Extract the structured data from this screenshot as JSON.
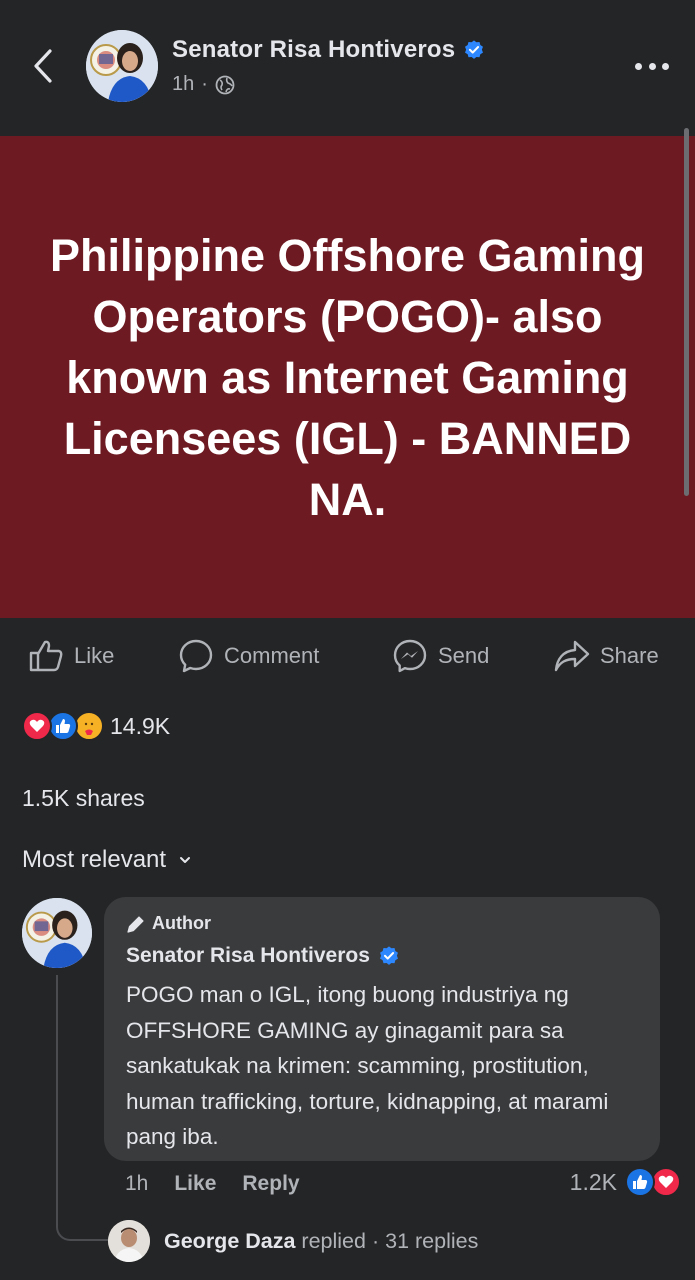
{
  "header": {
    "author_name": "Senator Risa Hontiveros",
    "time": "1h",
    "separator": "·"
  },
  "post": {
    "banner_text": "Philippine Offshore Gaming Operators (POGO)- also known as Internet Gaming Licensees (IGL) - BANNED NA.",
    "banner_color": "#6e1a22"
  },
  "actions": {
    "like": "Like",
    "comment": "Comment",
    "send": "Send",
    "share": "Share"
  },
  "stats": {
    "reaction_count": "14.9K",
    "shares": "1.5K shares"
  },
  "comments": {
    "sort_label": "Most relevant",
    "top": {
      "badge": "Author",
      "name": "Senator Risa Hontiveros",
      "text": "POGO man o IGL, itong buong industriya ng OFFSHORE GAMING ay ginagamit para sa sankatukak na krimen: scamming, prostitution, human trafficking, torture, kidnapping, at marami pang iba.",
      "time": "1h",
      "like": "Like",
      "reply": "Reply",
      "reaction_count": "1.2K"
    },
    "reply_summary": {
      "name": "George Daza",
      "verb": "replied",
      "dot": "·",
      "count": "31 replies"
    }
  },
  "colors": {
    "background": "#242526",
    "verified": "#2d88ff",
    "like_blue": "#1b74e4",
    "love_red": "#f02849"
  }
}
